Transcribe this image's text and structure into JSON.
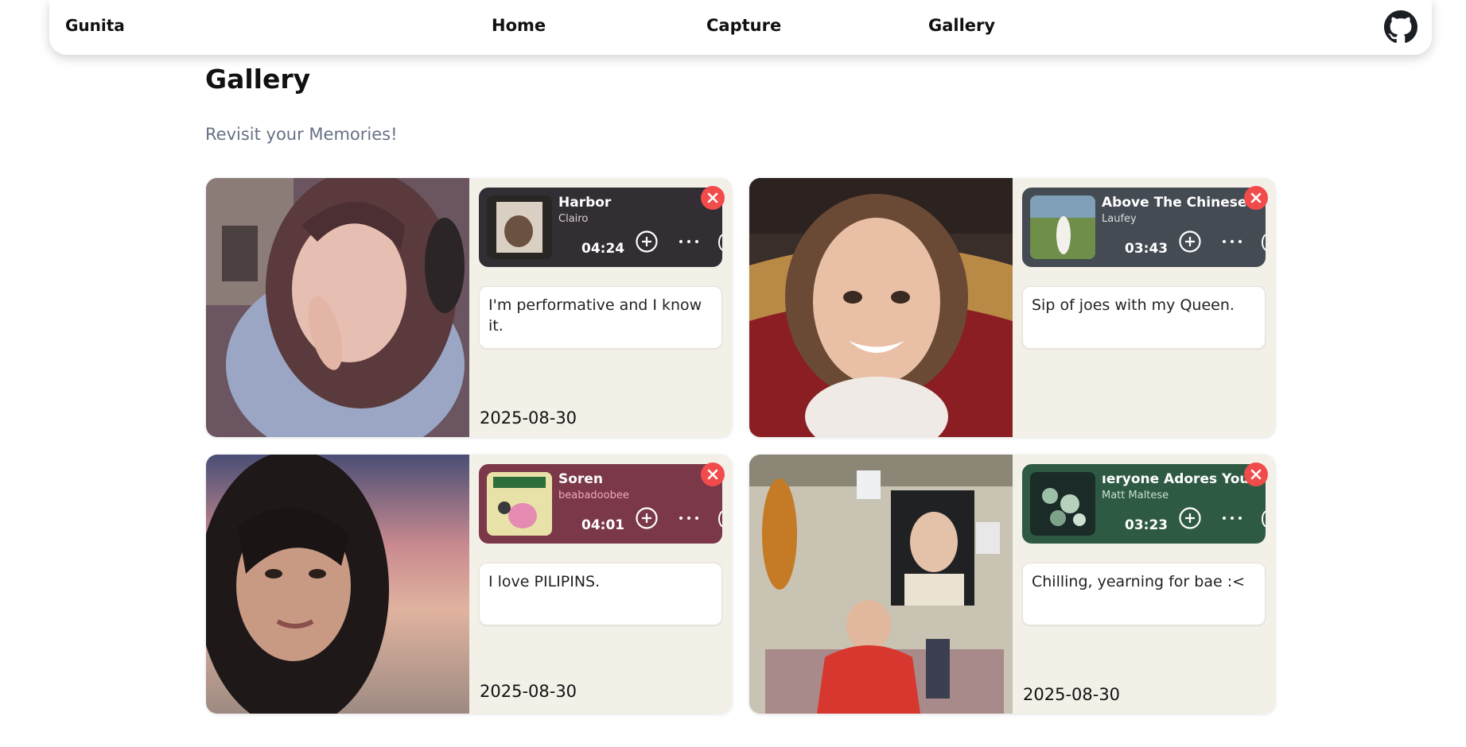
{
  "nav": {
    "brand": "Gunita",
    "links": [
      "Home",
      "Capture",
      "Gallery"
    ],
    "github_icon": "github-icon"
  },
  "page": {
    "title": "Gallery",
    "subtitle": "Revisit your Memories!"
  },
  "colors": {
    "card_bg": "#f3f0e8",
    "close_red": "#f14b4b",
    "text_muted": "#667085"
  },
  "cards": [
    {
      "song": {
        "title": "Harbor",
        "artist": "Clairo",
        "time": "04:24",
        "bg": "#332e33",
        "artist_color": "#d7d2d7"
      },
      "caption": "I'm performative and I know it.",
      "date": "2025-08-30"
    },
    {
      "song": {
        "title": "Above The Chinese Re",
        "artist": "Laufey",
        "time": "03:43",
        "bg": "#454b53",
        "artist_color": "#d9dde2"
      },
      "caption": "Sip of joes with my Queen.",
      "date": ""
    },
    {
      "song": {
        "title": "Soren",
        "artist": "beabadoobee",
        "time": "04:01",
        "bg": "#7a3849",
        "artist_color": "#f2a8bd"
      },
      "caption": "I love PILIPINS.",
      "date": "2025-08-30"
    },
    {
      "song": {
        "title": "ıeryone Adores You (a",
        "artist": "Matt Maltese",
        "time": "03:23",
        "bg": "#2e5a43",
        "artist_color": "#c5e0cf"
      },
      "caption": "Chilling, yearning for bae :<",
      "date": "2025-08-30"
    }
  ]
}
